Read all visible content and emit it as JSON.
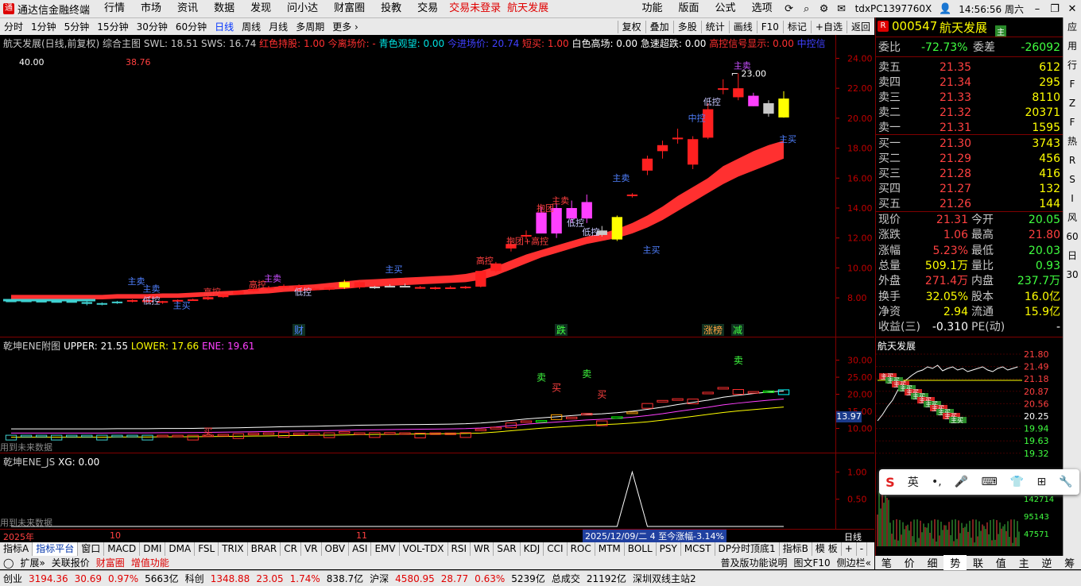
{
  "menu": {
    "app_title": "通达信金融终端",
    "items": [
      "行情",
      "市场",
      "资讯",
      "数据",
      "发现",
      "问小达",
      "财富圈",
      "投教",
      "交易"
    ],
    "alerts": [
      "交易未登录",
      "航天发展"
    ],
    "right": [
      "功能",
      "版面",
      "公式",
      "选项"
    ],
    "user": "tdxPC1397760X",
    "clock": "14:56:56 周六"
  },
  "periods": [
    "分时",
    "1分钟",
    "5分钟",
    "15分钟",
    "30分钟",
    "60分钟",
    "日线",
    "周线",
    "月线",
    "多周期",
    "更多"
  ],
  "period_active": "日线",
  "tools": [
    "复权",
    "叠加",
    "多股",
    "统计",
    "画线",
    "F10",
    "标记",
    "+自选",
    "返回"
  ],
  "main": {
    "header_stock": "航天发展(日线,前复权)",
    "header_items": [
      {
        "t": "综合主图",
        "c": "#c8c8c8"
      },
      {
        "t": "SWL: 18.51",
        "c": "#c8c8c8"
      },
      {
        "t": "SWS: 16.74",
        "c": "#c8c8c8"
      },
      {
        "t": "红色持股: 1.00",
        "c": "#ff3030"
      },
      {
        "t": "今离场价: -",
        "c": "#ff3030"
      },
      {
        "t": "青色观望: 0.00",
        "c": "#00e0e0"
      },
      {
        "t": "今进场价: 20.74",
        "c": "#4040ff"
      },
      {
        "t": "短买: 1.00",
        "c": "#ff3030"
      },
      {
        "t": "白色高场: 0.00",
        "c": "#ffffff"
      },
      {
        "t": "急速超跌: 0.00",
        "c": "#ffffff"
      },
      {
        "t": "高控信号显示: 0.00",
        "c": "#ff3030"
      },
      {
        "t": "中控信",
        "c": "#4040ff"
      }
    ],
    "top_left_value": "40.00",
    "top_left_value2": "38.76",
    "peak_label": "23.00",
    "axis_ticks": [
      "24.00",
      "22.00",
      "20.00",
      "18.00",
      "16.00",
      "14.00",
      "12.00",
      "10.00",
      "8.00"
    ],
    "event_markers": [
      {
        "t": "财",
        "c": "#5080ff"
      },
      {
        "t": "跌",
        "c": "#40ff40"
      },
      {
        "t": "涨榜",
        "c": "#ffa040"
      },
      {
        "t": "减",
        "c": "#40ff40"
      }
    ],
    "signals": [
      {
        "t": "主卖",
        "c": "#5080ff"
      },
      {
        "t": "低控",
        "c": "#c8c8ff"
      },
      {
        "t": "主买",
        "c": "#5080ff"
      },
      {
        "t": "高控",
        "c": "#ff4040"
      },
      {
        "t": "高控",
        "c": "#ff4040"
      },
      {
        "t": "主卖",
        "c": "#c850ff"
      },
      {
        "t": "低控",
        "c": "#c8c8ff"
      },
      {
        "t": "主卖",
        "c": "#5080ff"
      },
      {
        "t": "主买",
        "c": "#5080ff"
      },
      {
        "t": "高控",
        "c": "#ff4040"
      },
      {
        "t": "抱团+高控",
        "c": "#ff4040"
      },
      {
        "t": "抱团",
        "c": "#ff4040"
      },
      {
        "t": "主卖",
        "c": "#ff4040"
      },
      {
        "t": "主卖",
        "c": "#5080ff"
      },
      {
        "t": "低控",
        "c": "#c8c8ff"
      },
      {
        "t": "主买",
        "c": "#5080ff"
      },
      {
        "t": "中控",
        "c": "#5080ff"
      },
      {
        "t": "低控",
        "c": "#c8c8ff"
      },
      {
        "t": "主卖",
        "c": "#c850ff"
      },
      {
        "t": "主买",
        "c": "#5080ff"
      },
      {
        "t": "低控",
        "c": "#c8c8ff"
      }
    ]
  },
  "chart_data": [
    {
      "type": "candlestick",
      "title": "航天发展(日线,前复权)",
      "ylim": [
        7,
        24.5
      ],
      "x": [
        "d1",
        "d2",
        "d3",
        "d4",
        "d5",
        "d6",
        "d7",
        "d8",
        "d9",
        "d10",
        "d11",
        "d12",
        "d13",
        "d14",
        "d15",
        "d16",
        "d17",
        "d18",
        "d19",
        "d20",
        "d21",
        "d22",
        "d23",
        "d24",
        "d25",
        "d26",
        "d27",
        "d28",
        "d29",
        "d30",
        "d31",
        "d32",
        "d33",
        "d34",
        "d35",
        "d36",
        "d37",
        "d38",
        "d39",
        "d40",
        "d41",
        "d42",
        "d43",
        "d44",
        "d45",
        "d46",
        "d47",
        "d48",
        "d49",
        "d50",
        "d51",
        "d52",
        "d53",
        "d54"
      ],
      "ohlc": [
        [
          7.8,
          7.85,
          7.75,
          7.82
        ],
        [
          7.82,
          7.86,
          7.74,
          7.8
        ],
        [
          7.8,
          7.84,
          7.72,
          7.74
        ],
        [
          7.74,
          7.8,
          7.7,
          7.78
        ],
        [
          7.78,
          7.82,
          7.7,
          7.72
        ],
        [
          7.72,
          7.8,
          7.5,
          7.6
        ],
        [
          7.6,
          7.7,
          7.5,
          7.65
        ],
        [
          7.65,
          7.8,
          7.6,
          7.75
        ],
        [
          7.75,
          7.9,
          7.7,
          7.85
        ],
        [
          7.85,
          7.9,
          7.7,
          7.72
        ],
        [
          7.72,
          7.8,
          7.6,
          7.78
        ],
        [
          7.78,
          7.9,
          7.7,
          7.86
        ],
        [
          7.86,
          7.95,
          7.8,
          7.9
        ],
        [
          7.9,
          8.1,
          7.85,
          8.05
        ],
        [
          8.05,
          8.3,
          8.0,
          8.25
        ],
        [
          8.25,
          8.5,
          8.2,
          8.45
        ],
        [
          8.45,
          8.7,
          8.4,
          8.6
        ],
        [
          8.6,
          8.8,
          8.5,
          8.7
        ],
        [
          8.7,
          8.9,
          8.6,
          8.8
        ],
        [
          8.8,
          8.9,
          8.6,
          8.62
        ],
        [
          8.62,
          8.7,
          8.5,
          8.55
        ],
        [
          8.55,
          8.75,
          8.5,
          8.7
        ],
        [
          8.7,
          9.2,
          8.6,
          9.05
        ],
        [
          9.05,
          9.1,
          8.6,
          8.7
        ],
        [
          8.7,
          8.8,
          8.6,
          8.75
        ],
        [
          8.75,
          8.9,
          8.7,
          8.8
        ],
        [
          8.8,
          8.95,
          8.7,
          8.72
        ],
        [
          8.72,
          8.8,
          8.6,
          8.62
        ],
        [
          8.62,
          8.75,
          8.55,
          8.7
        ],
        [
          8.7,
          8.8,
          8.6,
          8.65
        ],
        [
          8.65,
          8.8,
          8.6,
          8.75
        ],
        [
          8.75,
          9.8,
          8.7,
          9.8
        ],
        [
          9.8,
          10.4,
          9.7,
          10.3
        ],
        [
          11.3,
          11.8,
          11.1,
          11.6
        ],
        [
          12.1,
          12.5,
          11.9,
          12.2
        ],
        [
          13.7,
          14.1,
          12.3,
          12.3
        ],
        [
          12.3,
          14.3,
          12.0,
          14.0
        ],
        [
          14.0,
          14.5,
          13.0,
          13.3
        ],
        [
          13.3,
          14.9,
          13.0,
          14.4
        ],
        [
          12.5,
          12.8,
          12.1,
          12.2
        ],
        [
          11.9,
          13.5,
          11.8,
          13.4
        ],
        [
          14.9,
          15.0,
          14.7,
          14.8
        ],
        [
          16.5,
          17.5,
          16.2,
          17.3
        ],
        [
          17.8,
          18.5,
          17.3,
          18.2
        ],
        [
          18.6,
          19.3,
          18.3,
          18.7
        ],
        [
          16.9,
          18.8,
          16.6,
          18.6
        ],
        [
          18.7,
          21.0,
          18.6,
          20.6
        ],
        [
          21.9,
          22.6,
          21.6,
          22.0
        ],
        [
          22.0,
          23.0,
          21.2,
          21.4
        ],
        [
          21.5,
          21.7,
          20.8,
          20.8
        ],
        [
          20.3,
          21.2,
          20.1,
          21.0
        ],
        [
          20.05,
          21.8,
          20.03,
          21.31
        ]
      ],
      "band_upper": [
        8.2,
        8.2,
        8.2,
        8.2,
        8.2,
        8.2,
        8.2,
        8.25,
        8.25,
        8.25,
        8.3,
        8.3,
        8.35,
        8.4,
        8.45,
        8.5,
        8.6,
        8.7,
        8.8,
        8.85,
        8.9,
        9.0,
        9.1,
        9.2,
        9.25,
        9.3,
        9.35,
        9.4,
        9.45,
        9.5,
        9.6,
        9.8,
        10.1,
        10.5,
        10.9,
        11.2,
        11.5,
        11.8,
        12.1,
        12.3,
        12.6,
        13.0,
        13.5,
        14.1,
        14.8,
        15.4,
        16.0,
        16.8,
        17.3,
        17.8,
        18.2,
        18.5
      ],
      "band_lower": [
        7.9,
        7.9,
        7.9,
        7.9,
        7.9,
        7.9,
        7.9,
        7.95,
        7.95,
        7.95,
        8.0,
        8.0,
        8.05,
        8.1,
        8.15,
        8.2,
        8.25,
        8.3,
        8.4,
        8.45,
        8.5,
        8.55,
        8.6,
        8.7,
        8.75,
        8.8,
        8.85,
        8.9,
        8.95,
        9.0,
        9.05,
        9.2,
        9.5,
        9.9,
        10.3,
        10.7,
        11.0,
        11.3,
        11.6,
        11.8,
        12.0,
        12.3,
        12.7,
        13.2,
        13.8,
        14.4,
        15.0,
        15.6,
        16.1,
        16.5,
        16.9,
        17.3
      ]
    }
  ],
  "sub1": {
    "header": "乾坤ENE附图",
    "items": [
      {
        "t": "UPPER: 21.55",
        "c": "#ffffff"
      },
      {
        "t": "LOWER: 17.66",
        "c": "#ffff00"
      },
      {
        "t": "ENE: 19.61",
        "c": "#ff40ff"
      }
    ],
    "axis_ticks": [
      "30.00",
      "25.00",
      "20.00",
      "15.00",
      "10.00"
    ],
    "current_value": "13.97",
    "future_label": "用到未来数据",
    "labels": [
      {
        "t": "买",
        "c": "#ff4040"
      },
      {
        "t": "卖",
        "c": "#40ff40"
      },
      {
        "t": "买",
        "c": "#ff4040"
      },
      {
        "t": "卖",
        "c": "#40ff40"
      },
      {
        "t": "买",
        "c": "#ff4040"
      },
      {
        "t": "卖",
        "c": "#40ff40"
      }
    ]
  },
  "sub2": {
    "header": "乾坤ENE_JS",
    "item": "XG: 0.00",
    "axis_ticks": [
      "1.00",
      "0.50"
    ],
    "future_label": "用到未来数据"
  },
  "timebar": {
    "labels": [
      "2025年",
      "10",
      "11"
    ],
    "info": "2025/12/09/二 4 至今涨幅-3.14%",
    "axis_label": "日线"
  },
  "quote": {
    "code": "000547",
    "name": "航天发展",
    "badge": "R",
    "tag": "主",
    "wei": {
      "label1": "委比",
      "val1": "-72.73%",
      "label2": "委差",
      "val2": "-26092"
    },
    "asks": [
      {
        "l": "卖五",
        "p": "21.35",
        "v": "612"
      },
      {
        "l": "卖四",
        "p": "21.34",
        "v": "295"
      },
      {
        "l": "卖三",
        "p": "21.33",
        "v": "8110"
      },
      {
        "l": "卖二",
        "p": "21.32",
        "v": "20371"
      },
      {
        "l": "卖一",
        "p": "21.31",
        "v": "1595"
      }
    ],
    "bids": [
      {
        "l": "买一",
        "p": "21.30",
        "v": "3743"
      },
      {
        "l": "买二",
        "p": "21.29",
        "v": "456"
      },
      {
        "l": "买三",
        "p": "21.28",
        "v": "416"
      },
      {
        "l": "买四",
        "p": "21.27",
        "v": "132"
      },
      {
        "l": "买五",
        "p": "21.26",
        "v": "144"
      }
    ],
    "stats": [
      {
        "l1": "现价",
        "v1": "21.31",
        "c1": "#ff4040",
        "l2": "今开",
        "v2": "20.05",
        "c2": "#40ff40"
      },
      {
        "l1": "涨跌",
        "v1": "1.06",
        "c1": "#ff4040",
        "l2": "最高",
        "v2": "21.80",
        "c2": "#ff4040"
      },
      {
        "l1": "涨幅",
        "v1": "5.23%",
        "c1": "#ff4040",
        "l2": "最低",
        "v2": "20.03",
        "c2": "#40ff40"
      },
      {
        "l1": "总量",
        "v1": "509.1万",
        "c1": "#ffff00",
        "l2": "量比",
        "v2": "0.93",
        "c2": "#40ff40"
      },
      {
        "l1": "外盘",
        "v1": "271.4万",
        "c1": "#ff4040",
        "l2": "内盘",
        "v2": "237.7万",
        "c2": "#40ff40"
      },
      {
        "l1": "换手",
        "v1": "32.05%",
        "c1": "#ffff00",
        "l2": "股本",
        "v2": "16.0亿",
        "c2": "#ffff00"
      },
      {
        "l1": "净资",
        "v1": "2.94",
        "c1": "#ffff00",
        "l2": "流通",
        "v2": "15.9亿",
        "c2": "#ffff00"
      },
      {
        "l1": "收益(三)",
        "v1": "-0.310",
        "c1": "#ffffff",
        "l2": "PE(动)",
        "v2": "-",
        "c2": "#ffffff"
      }
    ]
  },
  "mini": {
    "title": "航天发展",
    "ticks": [
      "21.80",
      "21.49",
      "21.18",
      "20.87",
      "20.56",
      "20.25",
      "19.94",
      "19.63",
      "19.32"
    ],
    "vol_ticks": [
      "142714",
      "95143",
      "47571"
    ],
    "tag": "主买"
  },
  "sidebar": [
    "应",
    "用",
    "行",
    "F",
    "Z",
    "F",
    "热",
    "R",
    "S",
    "I",
    "风",
    "60",
    "日",
    "30"
  ],
  "tabs": [
    "指标A",
    "指标平台",
    "窗口",
    "MACD",
    "DMI",
    "DMA",
    "FSL",
    "TRIX",
    "BRAR",
    "CR",
    "VR",
    "OBV",
    "ASI",
    "EMV",
    "VOL-TDX",
    "RSI",
    "WR",
    "SAR",
    "KDJ",
    "CCI",
    "ROC",
    "MTM",
    "BOLL",
    "PSY",
    "MCST",
    "DP分时顶底1"
  ],
  "tabs_right": [
    "指标B",
    "模 板",
    "+",
    "-"
  ],
  "tabs2": [
    "扩展»",
    "关联报价",
    "财富圈",
    "增值功能"
  ],
  "tabs2_right": [
    "普及版功能说明",
    "图文F10",
    "侧边栏«"
  ],
  "rtabs": [
    "笔",
    "价",
    "细",
    "势",
    "联",
    "值",
    "主",
    "逆",
    "筹"
  ],
  "status": [
    {
      "t": "创业",
      "c": "#000"
    },
    {
      "t": "3194.36",
      "c": "#e00000"
    },
    {
      "t": "30.69",
      "c": "#e00000"
    },
    {
      "t": "0.97%",
      "c": "#e00000"
    },
    {
      "t": "5663亿",
      "c": "#000"
    },
    {
      "t": "科创",
      "c": "#000"
    },
    {
      "t": "1348.88",
      "c": "#e00000"
    },
    {
      "t": "23.05",
      "c": "#e00000"
    },
    {
      "t": "1.74%",
      "c": "#e00000"
    },
    {
      "t": "838.7亿",
      "c": "#000"
    },
    {
      "t": "沪深",
      "c": "#000"
    },
    {
      "t": "4580.95",
      "c": "#e00000"
    },
    {
      "t": "28.77",
      "c": "#e00000"
    },
    {
      "t": "0.63%",
      "c": "#e00000"
    },
    {
      "t": "5239亿",
      "c": "#000"
    },
    {
      "t": "总成交",
      "c": "#000"
    },
    {
      "t": "21192亿",
      "c": "#000"
    },
    {
      "t": "深圳双线主站2",
      "c": "#000"
    }
  ],
  "ime": [
    "S",
    "英",
    "•",
    "mic",
    "kbd",
    "shirt",
    "grid",
    "tool"
  ]
}
